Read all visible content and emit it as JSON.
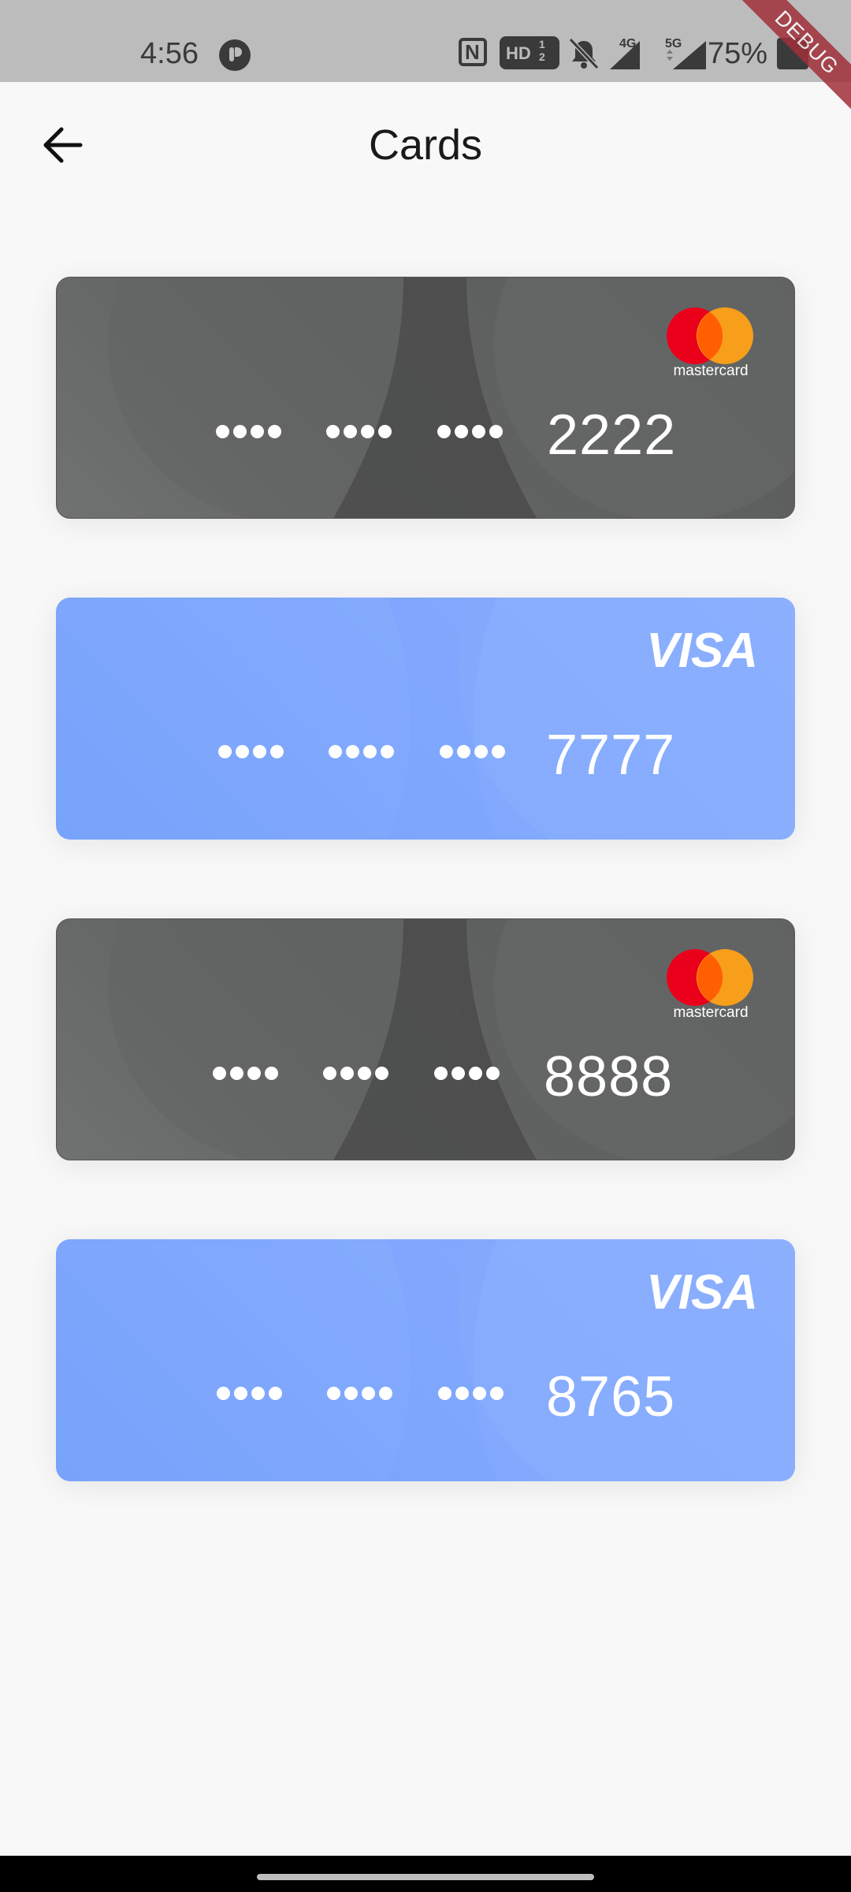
{
  "status_bar": {
    "time": "4:56",
    "network_badge": "HD",
    "network_badge_sub": "1\n2",
    "signal_1": "4G",
    "signal_2": "5G",
    "battery": "75%",
    "icons": [
      "app-notification-icon",
      "nfc-icon",
      "hd-voice-icon",
      "bell-muted-icon",
      "signal-4g-icon",
      "signal-5g-icon",
      "battery-icon"
    ]
  },
  "debug_banner": "DEBUG",
  "app_bar": {
    "title": "Cards",
    "back_icon": "arrow-left-icon"
  },
  "cards": [
    {
      "brand": "mastercard",
      "brand_label": "mastercard",
      "masked": [
        "••••",
        "••••",
        "••••"
      ],
      "last4": "2222"
    },
    {
      "brand": "visa",
      "brand_label": "VISA",
      "masked": [
        "••••",
        "••••",
        "••••"
      ],
      "last4": "7777"
    },
    {
      "brand": "mastercard",
      "brand_label": "mastercard",
      "masked": [
        "••••",
        "••••",
        "••••"
      ],
      "last4": "8888"
    },
    {
      "brand": "visa",
      "brand_label": "VISA",
      "masked": [
        "••••",
        "••••",
        "••••"
      ],
      "last4": "8765"
    }
  ],
  "colors": {
    "mastercard_card": "#636565",
    "visa_card": "#82a9fd",
    "mastercard_red": "#eb001b",
    "mastercard_orange": "#f79e1b",
    "background": "#f8f8f8"
  }
}
